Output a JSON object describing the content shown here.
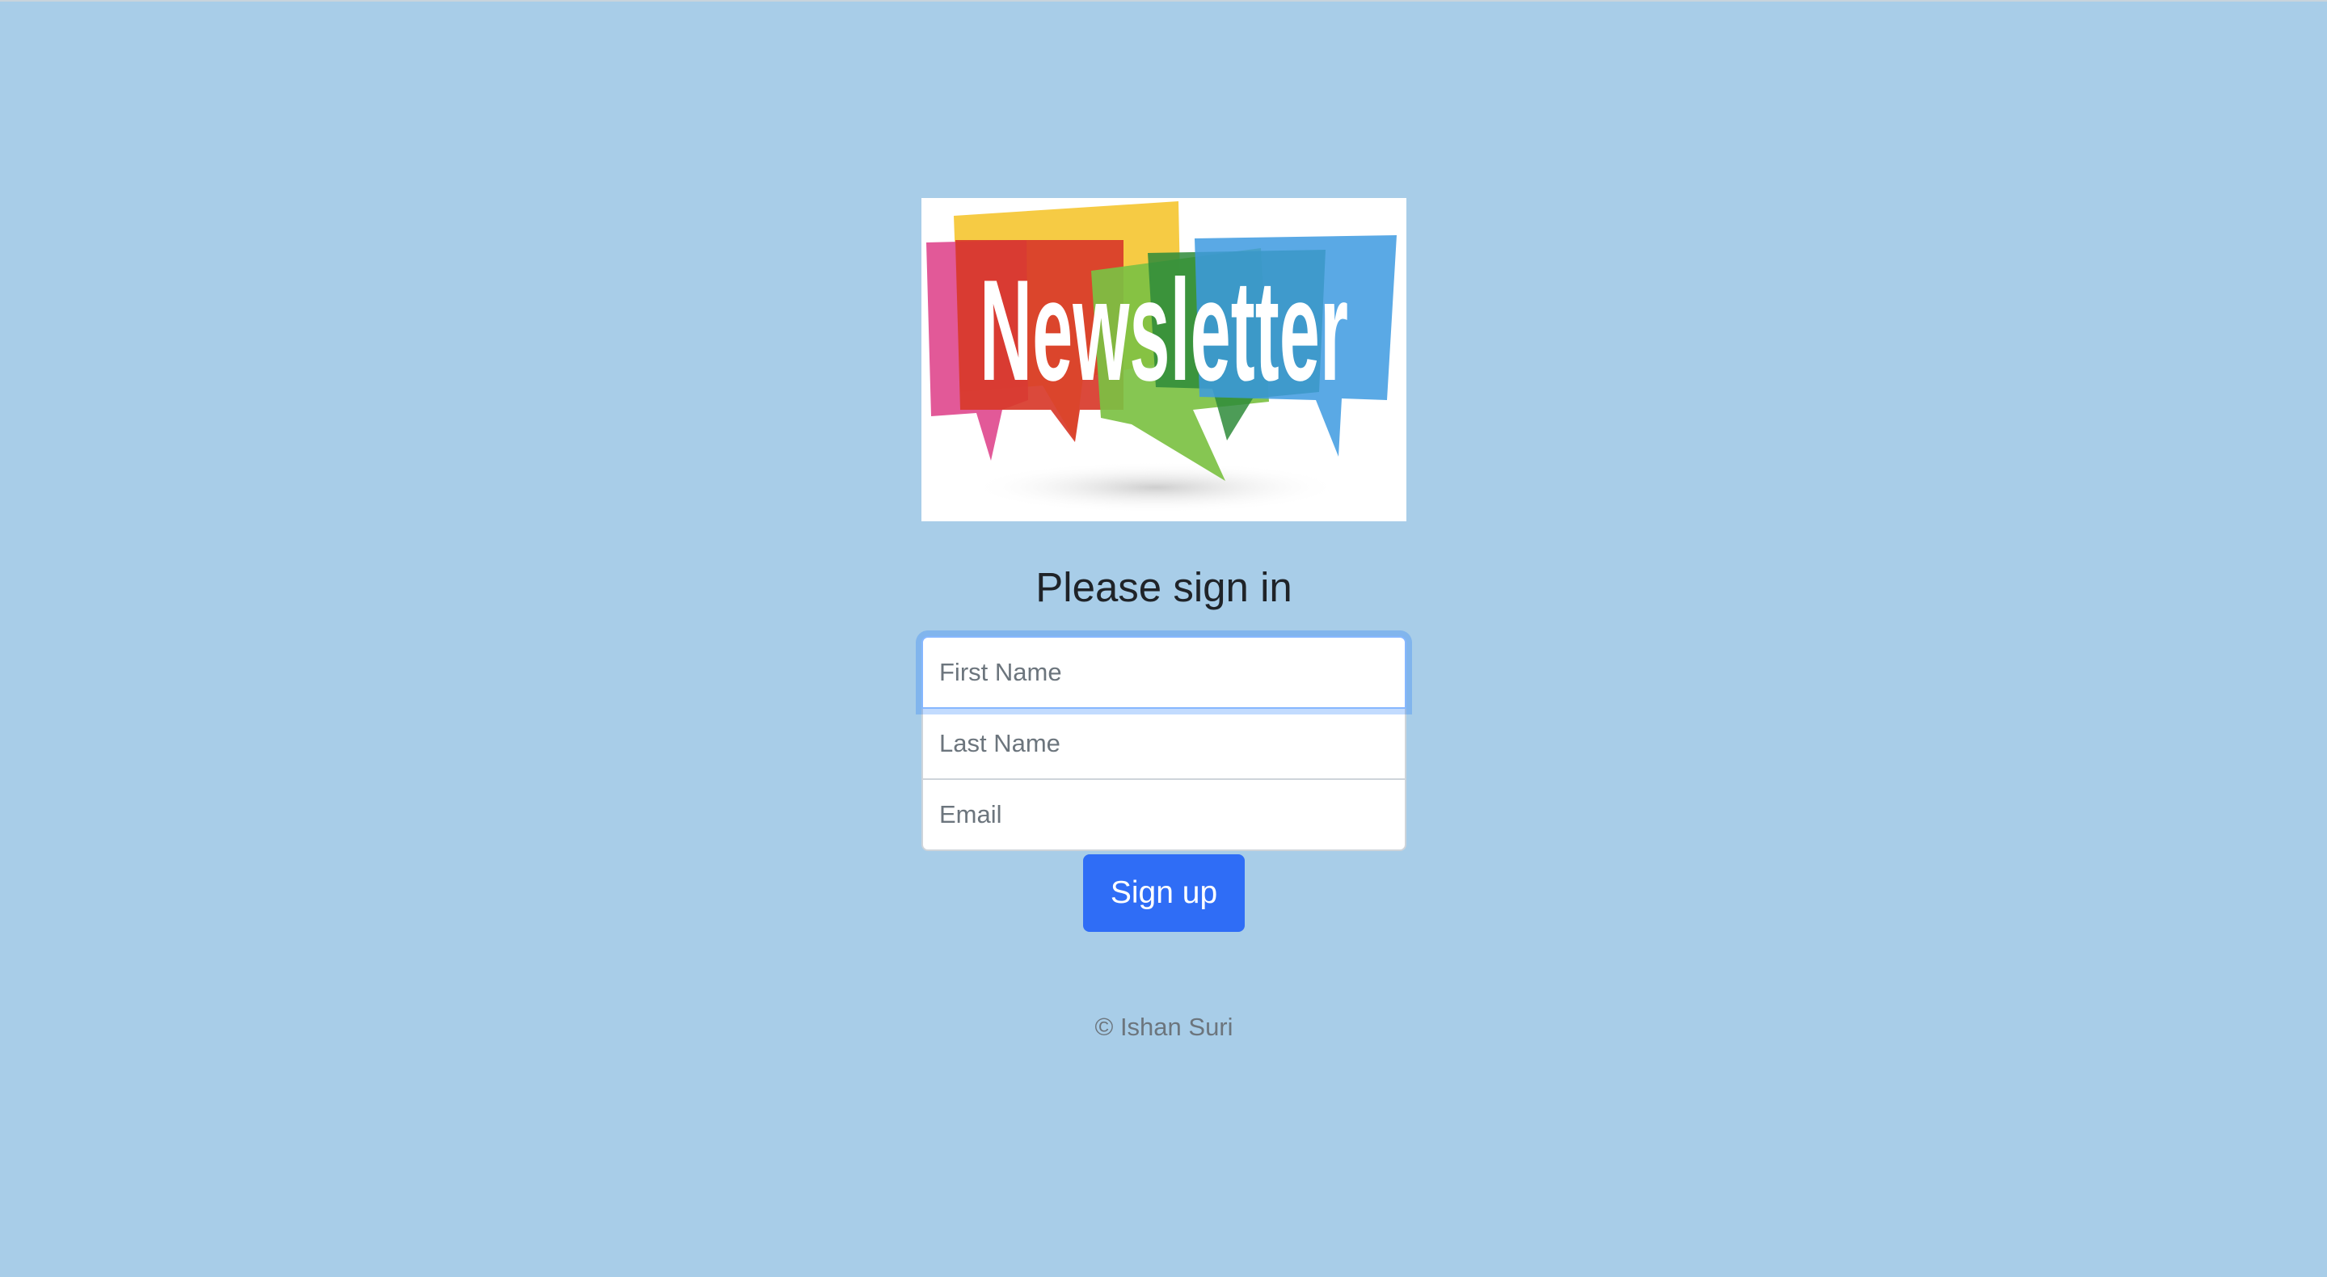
{
  "logo": {
    "text": "Newsletter",
    "colors": [
      "#e04b8f",
      "#f5c83a",
      "#d83a2a",
      "#7cc143",
      "#2e8b3a",
      "#3d9ae0"
    ]
  },
  "heading": "Please sign in",
  "form": {
    "first_name_placeholder": "First Name",
    "last_name_placeholder": "Last Name",
    "email_placeholder": "Email",
    "submit_label": "Sign up"
  },
  "footer": {
    "copyright": "© Ishan Suri"
  },
  "colors": {
    "background": "#a8cde8",
    "button": "#2f6df6",
    "focus_ring": "#86b7fe"
  }
}
